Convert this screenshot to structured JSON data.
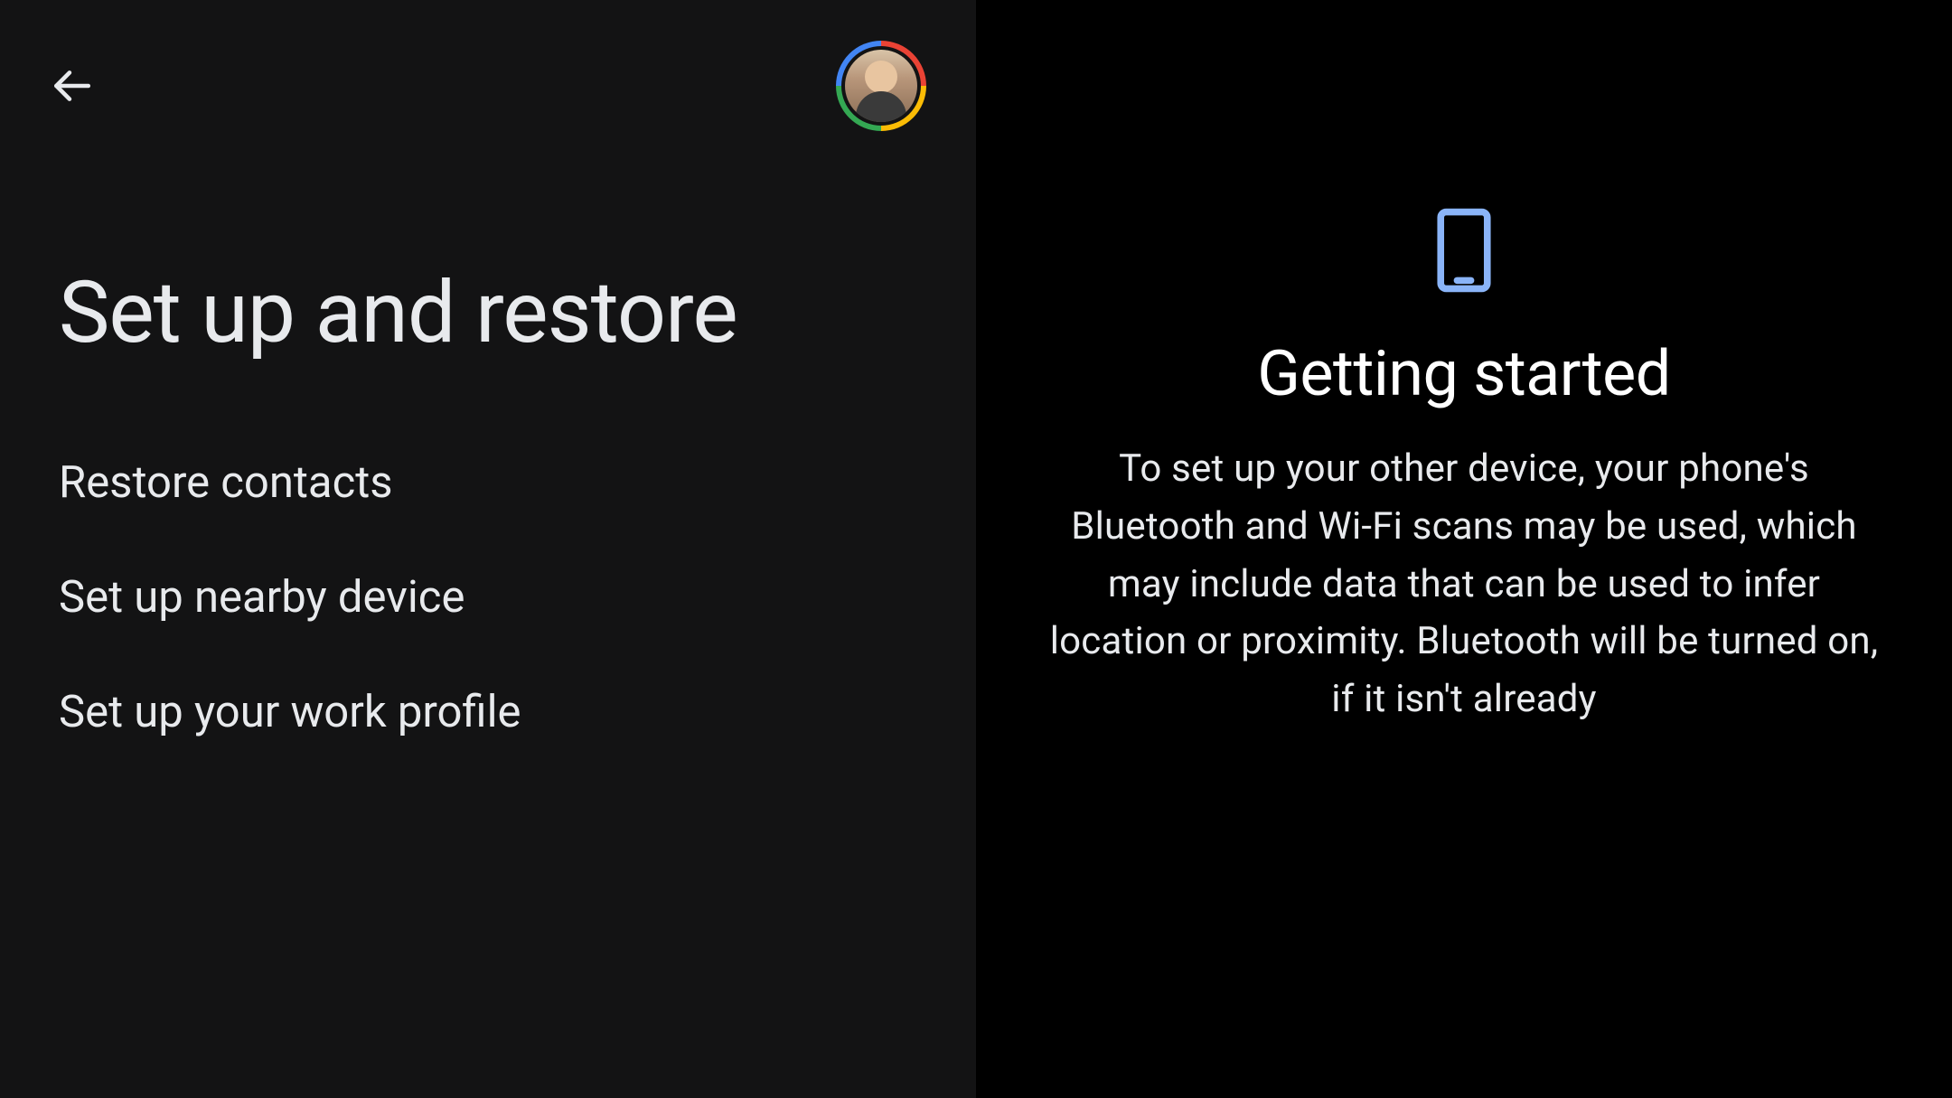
{
  "left": {
    "title": "Set up and restore",
    "menu": [
      {
        "label": "Restore contacts"
      },
      {
        "label": "Set up nearby device"
      },
      {
        "label": "Set up your work profile"
      }
    ]
  },
  "right": {
    "title": "Getting started",
    "body": "To set up your other device, your phone's Bluetooth and Wi-Fi scans may be used, which may include data that can be used to infer location or proximity. Bluetooth will be turned on, if it isn't already"
  },
  "colors": {
    "accent": "#8ab4f8",
    "leftBg": "#131314",
    "rightBg": "#000000",
    "text": "#e8eaed"
  }
}
